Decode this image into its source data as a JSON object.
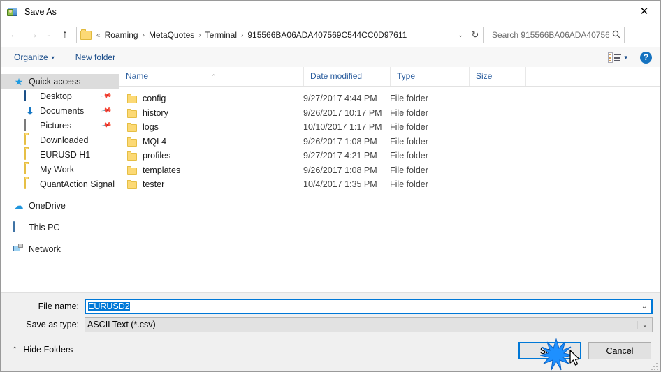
{
  "window": {
    "title": "Save As",
    "icon": "save-as-icon",
    "close_label": "✕"
  },
  "nav": {
    "back": "←",
    "forward": "→",
    "recent": "⌄",
    "up": "↑",
    "address": {
      "leading": "«",
      "crumbs": [
        "Roaming",
        "MetaQuotes",
        "Terminal",
        "915566BA06ADA407569C544CC0D97611"
      ],
      "separator": "›",
      "dropdown": "⌄",
      "refresh": "↻"
    },
    "search": {
      "placeholder": "Search 915566BA06ADA40756...",
      "icon": "🔍"
    }
  },
  "toolbar": {
    "organize_label": "Organize",
    "organize_caret": "▾",
    "new_folder_label": "New folder",
    "view_caret": "▾",
    "help_label": "?"
  },
  "sidebar": {
    "items": [
      {
        "label": "Quick access",
        "icon": "star-icon",
        "level": 0,
        "selected": true,
        "pinned": false
      },
      {
        "label": "Desktop",
        "icon": "desktop-icon",
        "level": 1,
        "selected": false,
        "pinned": true
      },
      {
        "label": "Documents",
        "icon": "download-arrow-icon",
        "level": 1,
        "selected": false,
        "pinned": true
      },
      {
        "label": "Pictures",
        "icon": "pictures-icon",
        "level": 1,
        "selected": false,
        "pinned": true
      },
      {
        "label": "Downloaded",
        "icon": "folder-icon",
        "level": 1,
        "selected": false,
        "pinned": false
      },
      {
        "label": "EURUSD H1",
        "icon": "folder-icon",
        "level": 1,
        "selected": false,
        "pinned": false
      },
      {
        "label": "My Work",
        "icon": "folder-icon",
        "level": 1,
        "selected": false,
        "pinned": false
      },
      {
        "label": "QuantAction Signal",
        "icon": "folder-icon",
        "level": 1,
        "selected": false,
        "pinned": false
      },
      {
        "label": "OneDrive",
        "icon": "cloud-icon",
        "level": 0,
        "selected": false,
        "pinned": false,
        "gap_before": true
      },
      {
        "label": "This PC",
        "icon": "pc-icon",
        "level": 0,
        "selected": false,
        "pinned": false,
        "gap_before": true
      },
      {
        "label": "Network",
        "icon": "network-icon",
        "level": 0,
        "selected": false,
        "pinned": false,
        "gap_before": true
      }
    ]
  },
  "filelist": {
    "columns": {
      "name": "Name",
      "date_modified": "Date modified",
      "type": "Type",
      "size": "Size"
    },
    "sort_indicator": "⌃",
    "rows": [
      {
        "name": "config",
        "date_modified": "9/27/2017 4:44 PM",
        "type": "File folder",
        "size": ""
      },
      {
        "name": "history",
        "date_modified": "9/26/2017 10:17 PM",
        "type": "File folder",
        "size": ""
      },
      {
        "name": "logs",
        "date_modified": "10/10/2017 1:17 PM",
        "type": "File folder",
        "size": ""
      },
      {
        "name": "MQL4",
        "date_modified": "9/26/2017 1:08 PM",
        "type": "File folder",
        "size": ""
      },
      {
        "name": "profiles",
        "date_modified": "9/27/2017 4:21 PM",
        "type": "File folder",
        "size": ""
      },
      {
        "name": "templates",
        "date_modified": "9/26/2017 1:08 PM",
        "type": "File folder",
        "size": ""
      },
      {
        "name": "tester",
        "date_modified": "10/4/2017 1:35 PM",
        "type": "File folder",
        "size": ""
      }
    ]
  },
  "form": {
    "filename_label": "File name:",
    "filename_value": "EURUSD2",
    "filetype_label": "Save as type:",
    "filetype_value": "ASCII Text (*.csv)",
    "dropdown_arrow": "⌄"
  },
  "footer": {
    "hide_folders_label": "Hide Folders",
    "hide_folders_caret": "⌃",
    "save_label": "Save",
    "cancel_label": "Cancel"
  },
  "colors": {
    "accent": "#0078d7",
    "link": "#1b4d8a",
    "folder": "#fcd975",
    "selection": "#dcdcdc"
  }
}
